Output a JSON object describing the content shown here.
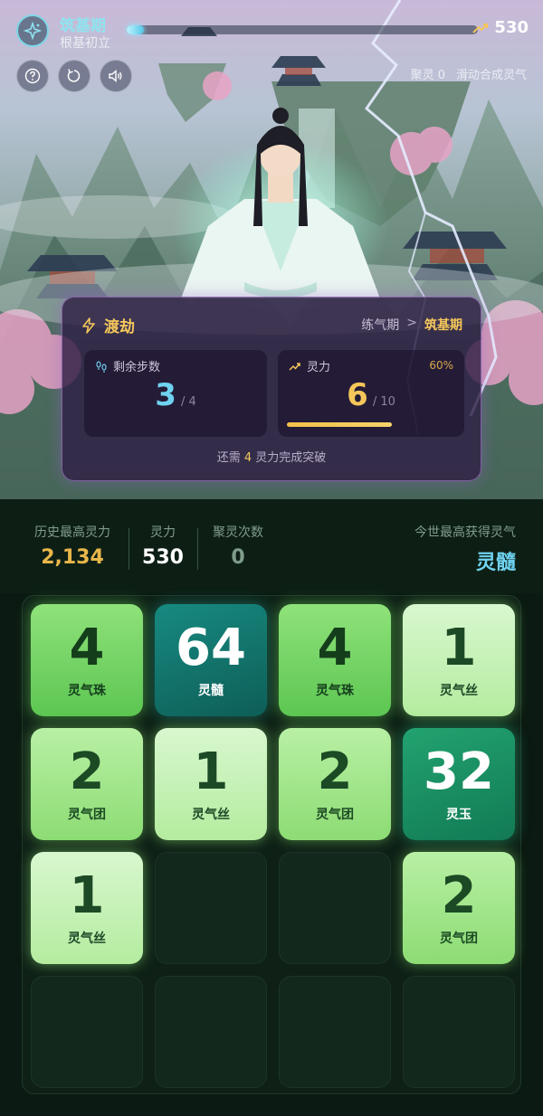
{
  "header": {
    "realm_title": "筑基期",
    "realm_subtitle": "根基初立",
    "realm_progress": 0.05,
    "score": "530"
  },
  "controls": {
    "help_icon": "question-icon",
    "restart_icon": "restart-icon",
    "sound_icon": "speaker-icon"
  },
  "hint": {
    "gather_label": "聚灵 0",
    "swipe_hint": "滑动合成灵气"
  },
  "tribulation": {
    "title": "渡劫",
    "stage_from": "练气期",
    "stage_separator": ">",
    "stage_to": "筑基期",
    "steps_label": "剩余步数",
    "steps_value": "3",
    "steps_total": "/ 4",
    "power_label": "灵力",
    "power_percent": "60%",
    "power_value": "6",
    "power_total": "/ 10",
    "power_fill": 0.6,
    "footer_prefix": "还需",
    "footer_amount": "4",
    "footer_suffix": "灵力完成突破"
  },
  "stats": {
    "best_label": "历史最高灵力",
    "best_value": "2,134",
    "power_label": "灵力",
    "power_value": "530",
    "gather_label": "聚灵次数",
    "gather_value": "0",
    "top_label": "今世最高获得灵气",
    "top_value": "灵髓"
  },
  "board": {
    "rows": [
      [
        {
          "num": "4",
          "name": "灵气珠",
          "style": "green"
        },
        {
          "num": "64",
          "name": "灵髓",
          "style": "teal"
        },
        {
          "num": "4",
          "name": "灵气珠",
          "style": "green"
        },
        {
          "num": "1",
          "name": "灵气丝",
          "style": "light"
        }
      ],
      [
        {
          "num": "2",
          "name": "灵气团",
          "style": "mid"
        },
        {
          "num": "1",
          "name": "灵气丝",
          "style": "light"
        },
        {
          "num": "2",
          "name": "灵气团",
          "style": "mid"
        },
        {
          "num": "32",
          "name": "灵玉",
          "style": "jade"
        }
      ],
      [
        {
          "num": "1",
          "name": "灵气丝",
          "style": "light"
        },
        null,
        null,
        {
          "num": "2",
          "name": "灵气团",
          "style": "mid"
        }
      ],
      [
        null,
        null,
        null,
        null
      ]
    ]
  },
  "colors": {
    "accent_cyan": "#8fe3ef",
    "accent_gold": "#f5c75a",
    "board_bg": "#0f2117"
  }
}
